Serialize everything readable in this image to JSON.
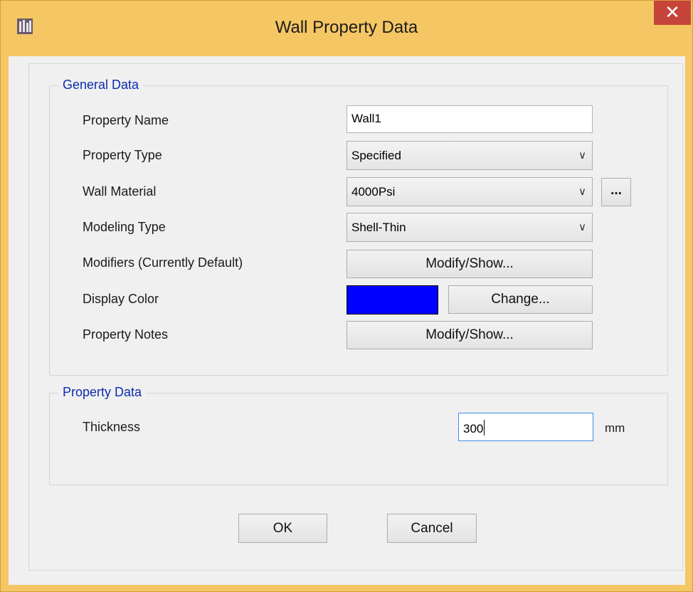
{
  "window": {
    "title": "Wall Property Data",
    "close_label": "✕"
  },
  "general_data": {
    "legend": "General Data",
    "property_name": {
      "label": "Property Name",
      "value": "Wall1"
    },
    "property_type": {
      "label": "Property Type",
      "value": "Specified"
    },
    "wall_material": {
      "label": "Wall Material",
      "value": "4000Psi",
      "browse_label": "..."
    },
    "modeling_type": {
      "label": "Modeling Type",
      "value": "Shell-Thin"
    },
    "modifiers": {
      "label": "Modifiers (Currently Default)",
      "button_label": "Modify/Show..."
    },
    "display_color": {
      "label": "Display Color",
      "color": "#0000ff",
      "button_label": "Change..."
    },
    "property_notes": {
      "label": "Property Notes",
      "button_label": "Modify/Show..."
    }
  },
  "property_data": {
    "legend": "Property Data",
    "thickness": {
      "label": "Thickness",
      "value": "300",
      "unit": "mm"
    }
  },
  "footer": {
    "ok_label": "OK",
    "cancel_label": "Cancel"
  },
  "colors": {
    "title_bar": "#f5c664",
    "close_button": "#c7443a",
    "legend_text": "#0b2cae",
    "focus_border": "#3c8de6"
  }
}
